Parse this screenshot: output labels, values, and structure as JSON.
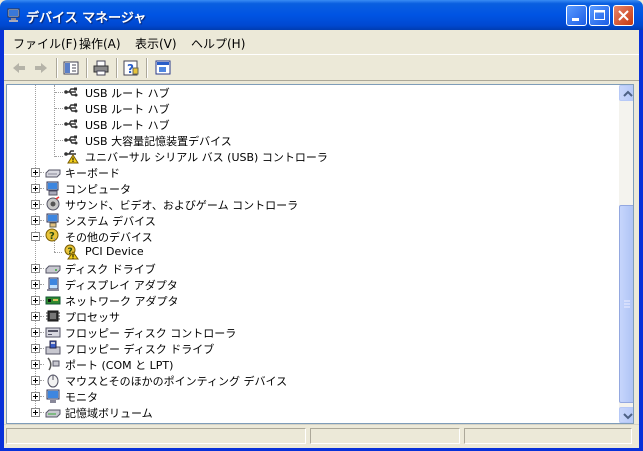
{
  "window": {
    "title": "デバイス マネージャ",
    "icon": "device-manager-icon"
  },
  "menu": {
    "file": "ファイル(F)",
    "action": "操作(A)",
    "view": "表示(V)",
    "help": "ヘルプ(H)"
  },
  "toolbar": {
    "items": [
      "back-icon",
      "forward-icon",
      "show-hide-tree-icon",
      "print-icon",
      "help-properties-icon",
      "properties-icon"
    ]
  },
  "tree": {
    "usb_children": [
      {
        "label": "USB ルート ハブ",
        "icon": "usb-icon"
      },
      {
        "label": "USB ルート ハブ",
        "icon": "usb-icon"
      },
      {
        "label": "USB ルート ハブ",
        "icon": "usb-icon"
      },
      {
        "label": "USB 大容量記憶装置デバイス",
        "icon": "usb-icon"
      },
      {
        "label": "ユニバーサル シリアル バス (USB) コントローラ",
        "icon": "usb-warning-icon"
      }
    ],
    "categories": [
      {
        "label": "キーボード",
        "icon": "keyboard-icon",
        "expanded": false
      },
      {
        "label": "コンピュータ",
        "icon": "computer-icon",
        "expanded": false
      },
      {
        "label": "サウンド、ビデオ、およびゲーム コントローラ",
        "icon": "sound-icon",
        "expanded": false
      },
      {
        "label": "システム デバイス",
        "icon": "system-device-icon",
        "expanded": false
      },
      {
        "label": "その他のデバイス",
        "icon": "other-device-icon",
        "expanded": true
      },
      {
        "label": "PCI Device",
        "icon": "unknown-device-warning-icon",
        "child": true
      },
      {
        "label": "ディスク ドライブ",
        "icon": "disk-drive-icon",
        "expanded": false
      },
      {
        "label": "ディスプレイ アダプタ",
        "icon": "display-adapter-icon",
        "expanded": false
      },
      {
        "label": "ネットワーク アダプタ",
        "icon": "network-adapter-icon",
        "expanded": false
      },
      {
        "label": "プロセッサ",
        "icon": "processor-icon",
        "expanded": false
      },
      {
        "label": "フロッピー ディスク コントローラ",
        "icon": "floppy-controller-icon",
        "expanded": false
      },
      {
        "label": "フロッピー ディスク ドライブ",
        "icon": "floppy-drive-icon",
        "expanded": false
      },
      {
        "label": "ポート (COM と LPT)",
        "icon": "port-icon",
        "expanded": false
      },
      {
        "label": "マウスとそのほかのポインティング デバイス",
        "icon": "mouse-icon",
        "expanded": false
      },
      {
        "label": "モニタ",
        "icon": "monitor-icon",
        "expanded": false
      },
      {
        "label": "記憶域ボリューム",
        "icon": "storage-volume-icon",
        "expanded": false
      }
    ]
  },
  "colors": {
    "titlebar": "#0054e3",
    "frame": "#0831d9",
    "face": "#ece9d8",
    "tree_border": "#7f9db9"
  }
}
